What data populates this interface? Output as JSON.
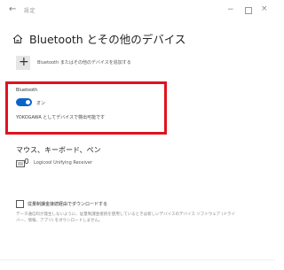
{
  "titlebar": {
    "back_glyph": "←",
    "title": "設定",
    "minimize_glyph": "−",
    "close_glyph": "×"
  },
  "header": {
    "title": "Bluetooth とその他のデバイス"
  },
  "add_device": {
    "plus_glyph": "+",
    "label": "Bluetooth またはその他のデバイスを追加する"
  },
  "bluetooth": {
    "heading": "Bluetooth",
    "toggle_state": "オン",
    "discoverable_text": "YOKOGAWA としてデバイスで検出可能です"
  },
  "peripherals": {
    "heading": "マウス、キーボード、ペン",
    "devices": [
      {
        "name": "Logicool Unifying Receiver",
        "icon": "keyboard-icon"
      }
    ]
  },
  "metered": {
    "label": "従量制課金接続経由でダウンロードする",
    "description": "データ通信料が発生しないように、従量制課金接続を使用しているときは新しいデバイスのデバイス ソフトウェア (ドライバー、情報、アプリ) をダウンロードしません。"
  },
  "colors": {
    "accent": "#0b63c9",
    "highlight": "#e0121d"
  }
}
